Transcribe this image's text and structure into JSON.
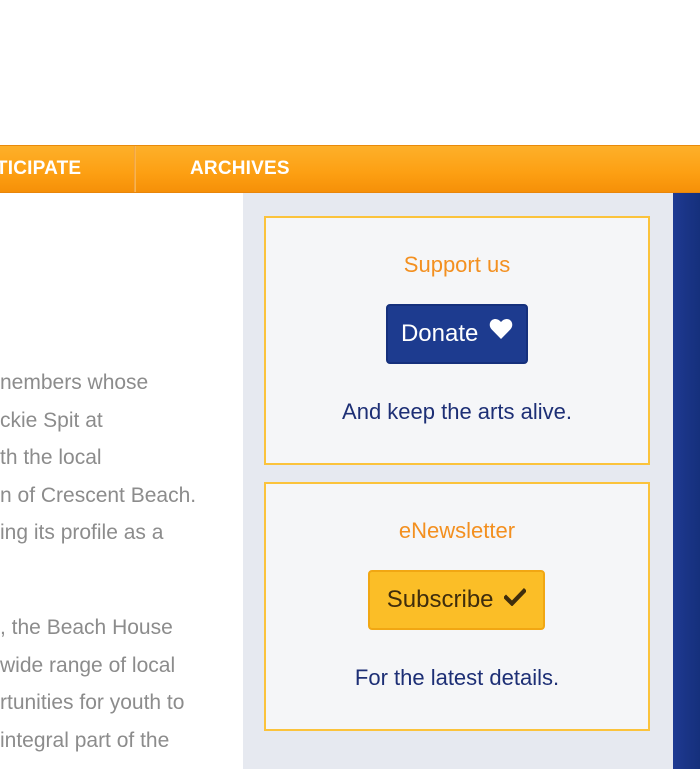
{
  "nav": {
    "items": [
      {
        "label": "RTICIPATE"
      },
      {
        "label": "ARCHIVES"
      }
    ]
  },
  "content": {
    "paragraph1": [
      "nembers whose",
      "ckie Spit at",
      "th the local",
      "n of Crescent Beach.",
      "ing its profile as a"
    ],
    "paragraph2": [
      ", the Beach House",
      "wide range of local",
      "rtunities for youth to",
      "integral part of the"
    ]
  },
  "sidebar": {
    "support": {
      "title": "Support us",
      "button_label": "Donate",
      "button_icon": "heart-icon",
      "text": "And keep the arts alive."
    },
    "newsletter": {
      "title": "eNewsletter",
      "button_label": "Subscribe",
      "button_icon": "checkmark-icon",
      "text": "For the latest details."
    }
  },
  "colors": {
    "nav_orange": "#fd9f12",
    "widget_border": "#fbc33c",
    "title_orange": "#f39020",
    "donate_blue": "#1d3b8f",
    "subscribe_yellow": "#fbbe27",
    "body_text_gray": "#8c8c8c",
    "sidebar_bg": "#e6e9f0",
    "right_panel_blue": "#1a3486"
  }
}
